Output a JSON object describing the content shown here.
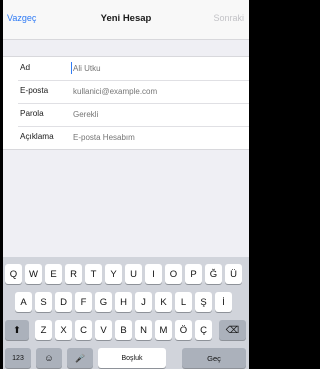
{
  "navbar": {
    "cancel": "Vazgeç",
    "title": "Yeni Hesap",
    "next": "Sonraki"
  },
  "form": {
    "rows": [
      {
        "label": "Ad",
        "placeholder": "Ali Utku"
      },
      {
        "label": "E-posta",
        "placeholder": "kullanici@example.com"
      },
      {
        "label": "Parola",
        "placeholder": "Gerekli"
      },
      {
        "label": "Açıklama",
        "placeholder": "E-posta Hesabım"
      }
    ]
  },
  "keyboard": {
    "row1": [
      "Q",
      "W",
      "E",
      "R",
      "T",
      "Y",
      "U",
      "I",
      "O",
      "P",
      "Ğ",
      "Ü"
    ],
    "row2": [
      "A",
      "S",
      "D",
      "F",
      "G",
      "H",
      "J",
      "K",
      "L",
      "Ş",
      "İ"
    ],
    "row3": [
      "Z",
      "X",
      "C",
      "V",
      "B",
      "N",
      "M",
      "Ö",
      "Ç"
    ],
    "shift_icon": "⬆",
    "delete_icon": "⌫",
    "numbers": "123",
    "emoji_icon": "☺",
    "mic_icon": "🎤",
    "space": "Boşluk",
    "go": "Geç"
  }
}
